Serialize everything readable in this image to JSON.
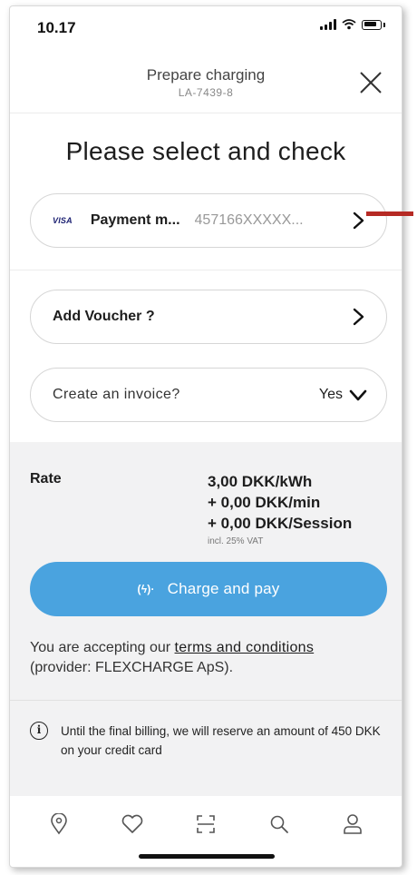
{
  "status_bar": {
    "time": "10.17"
  },
  "header": {
    "title": "Prepare charging",
    "subtitle": "LA-7439-8"
  },
  "page_title": "Please select and check",
  "payment": {
    "card_brand": "VISA",
    "label": "Payment m...",
    "value": "457166XXXXX..."
  },
  "voucher": {
    "label": "Add Voucher ?"
  },
  "invoice": {
    "label": "Create an invoice?",
    "value": "Yes"
  },
  "rate": {
    "label": "Rate",
    "lines": [
      "3,00 DKK/kWh",
      "+ 0,00 DKK/min",
      "+ 0,00 DKK/Session"
    ],
    "note": "incl. 25% VAT"
  },
  "charge_button": {
    "icon": "(ϟ)·",
    "label": "Charge and pay"
  },
  "terms": {
    "prefix": "You are accepting our",
    "link": "terms and conditions",
    "suffix": "(provider: FLEXCHARGE ApS)."
  },
  "info": {
    "text": "Until the final billing, we will reserve an amount of 450 DKK on your credit card"
  },
  "bottom_nav": [
    "map-pin-icon",
    "heart-icon",
    "scan-icon",
    "search-icon",
    "user-icon"
  ],
  "colors": {
    "primary": "#4aa3df",
    "annotation_arrow": "#b62a24",
    "section_bg": "#f2f2f3"
  }
}
